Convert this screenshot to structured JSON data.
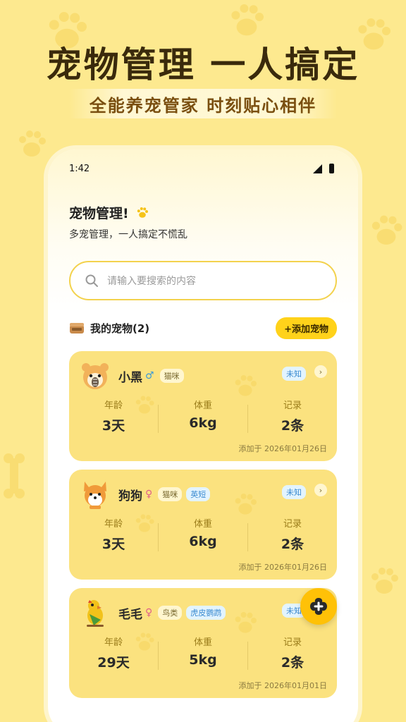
{
  "headline": "宠物管理 一人搞定",
  "subheadline": "全能养宠管家 时刻贴心相伴",
  "status_bar": {
    "time": "1:42"
  },
  "page": {
    "title": "宠物管理!",
    "subtitle": "多宠管理，一人搞定不慌乱"
  },
  "search": {
    "placeholder": "请输入要搜索的内容"
  },
  "section": {
    "title": "我的宠物(2)",
    "add_label": "+添加宠物"
  },
  "pets": [
    {
      "name": "小黑",
      "gender": "♂",
      "tags": [
        "猫咪"
      ],
      "status": "未知",
      "stats": [
        {
          "label": "年龄",
          "value": "3天"
        },
        {
          "label": "体重",
          "value": "6kg"
        },
        {
          "label": "记录",
          "value": "2条"
        }
      ],
      "added": "添加于 2026年01月26日"
    },
    {
      "name": "狗狗",
      "gender": "♀",
      "tags": [
        "猫咪",
        "英短"
      ],
      "status": "未知",
      "stats": [
        {
          "label": "年龄",
          "value": "3天"
        },
        {
          "label": "体重",
          "value": "6kg"
        },
        {
          "label": "记录",
          "value": "2条"
        }
      ],
      "added": "添加于 2026年01月26日"
    },
    {
      "name": "毛毛",
      "gender": "♀",
      "tags": [
        "鸟类",
        "虎皮鹦鹉"
      ],
      "status": "未知",
      "stats": [
        {
          "label": "年龄",
          "value": "29天"
        },
        {
          "label": "体重",
          "value": "5kg"
        },
        {
          "label": "记录",
          "value": "2条"
        }
      ],
      "added": "添加于 2026年01月01日"
    }
  ],
  "colors": {
    "background": "#fde98f",
    "accent": "#ffd21a",
    "card": "#fbe27f",
    "male": "#3a9ad9",
    "female": "#e0608a"
  },
  "icons": {
    "search": "search-icon",
    "paw": "paw-icon",
    "box": "pet-box-icon",
    "fab": "add-icon",
    "arrow": "chevron-right-icon"
  }
}
